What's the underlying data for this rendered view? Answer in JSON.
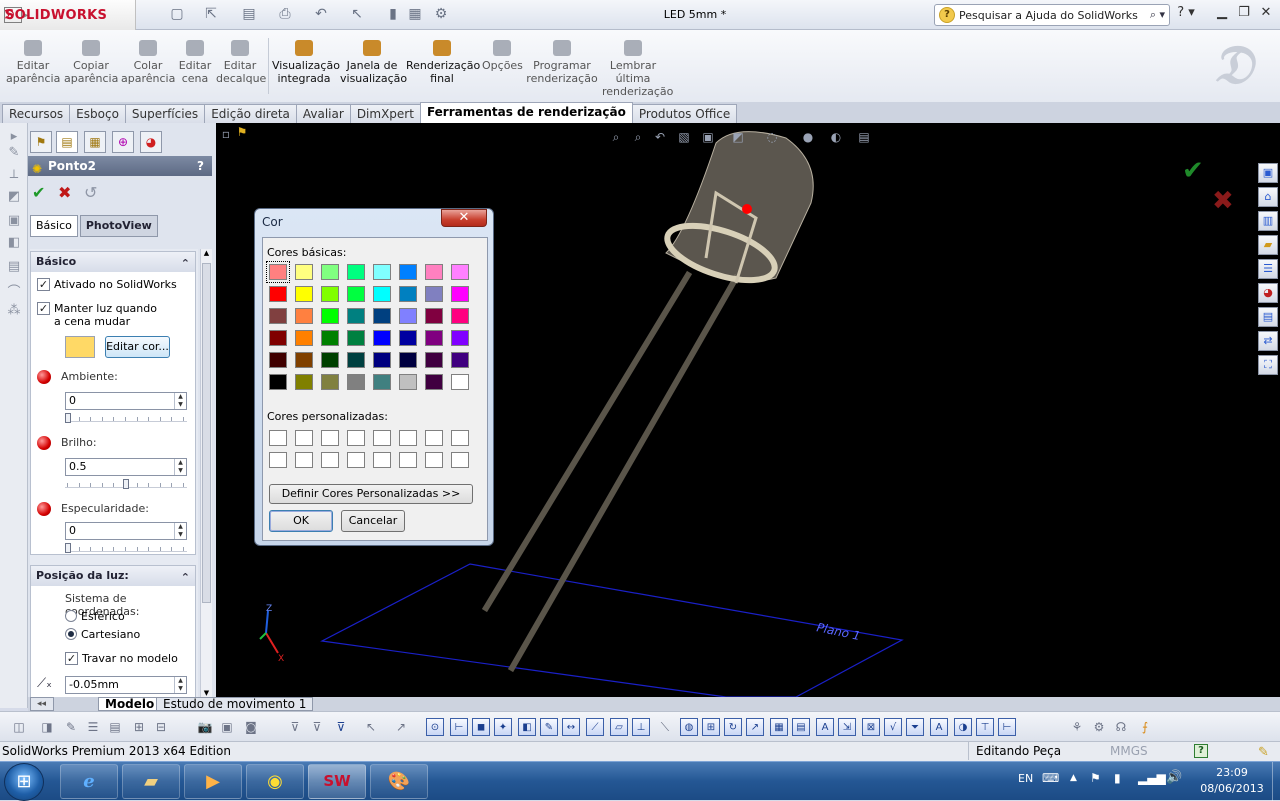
{
  "app": {
    "brand": "SOLIDWORKS",
    "document_title": "LED 5mm *",
    "help_search_placeholder": "Pesquisar a Ajuda do SolidWorks"
  },
  "ribbon": {
    "buttons": [
      {
        "label": "Editar aparência"
      },
      {
        "label": "Copiar aparência"
      },
      {
        "label": "Colar aparência"
      },
      {
        "label": "Editar cena"
      },
      {
        "label": "Editar decalque"
      },
      {
        "label": "Visualização integrada"
      },
      {
        "label": "Janela de visualização"
      },
      {
        "label": "Renderização final"
      },
      {
        "label": "Opções"
      },
      {
        "label": "Programar renderização"
      },
      {
        "label": "Lembrar última renderização"
      }
    ]
  },
  "tabs": [
    "Recursos",
    "Esboço",
    "Superfícies",
    "Edição direta",
    "Avaliar",
    "DimXpert",
    "Ferramentas de renderização",
    "Produtos Office"
  ],
  "active_tab": "Ferramentas de renderização",
  "property_manager": {
    "title": "Ponto2",
    "help": "?",
    "subtabs": [
      "Básico",
      "PhotoView"
    ],
    "basic_group": {
      "header": "Básico",
      "enabled_in_solidworks": "Ativado no SolidWorks",
      "keep_light": "Manter luz quando a cena mudar",
      "edit_color_button": "Editar cor...",
      "color": "#ffd966",
      "ambient_label": "Ambiente:",
      "ambient_value": "0",
      "ambient_fraction": 0,
      "brightness_label": "Brilho:",
      "brightness_value": "0.5",
      "brightness_fraction": 0.5,
      "specular_label": "Especularidade:",
      "specular_value": "0",
      "specular_fraction": 0
    },
    "position_group": {
      "header": "Posição da luz:",
      "coord_system_label": "Sistema de coordenadas:",
      "spherical": "Esférico",
      "cartesian": "Cartesiano",
      "lock_to_model": "Travar no modelo",
      "x_value": "-0.05mm"
    }
  },
  "color_dialog": {
    "title": "Cor",
    "close": "✕",
    "basic_colors_label": "Cores básicas:",
    "basic_colors": [
      [
        "#ff8080",
        "#ffff80",
        "#80ff80",
        "#00ff80",
        "#80ffff",
        "#0080ff",
        "#ff80c0",
        "#ff80ff"
      ],
      [
        "#ff0000",
        "#ffff00",
        "#80ff00",
        "#00ff40",
        "#00ffff",
        "#0080c0",
        "#8080c0",
        "#ff00ff"
      ],
      [
        "#804040",
        "#ff8040",
        "#00ff00",
        "#008080",
        "#004080",
        "#8080ff",
        "#800040",
        "#ff0080"
      ],
      [
        "#800000",
        "#ff8000",
        "#008000",
        "#008040",
        "#0000ff",
        "#0000a0",
        "#800080",
        "#8000ff"
      ],
      [
        "#400000",
        "#804000",
        "#004000",
        "#004040",
        "#000080",
        "#000040",
        "#400040",
        "#400080"
      ],
      [
        "#000000",
        "#808000",
        "#808040",
        "#808080",
        "#408080",
        "#c0c0c0",
        "#400040",
        "#ffffff"
      ]
    ],
    "custom_colors_label": "Cores personalizadas:",
    "define_custom_button": "Definir Cores Personalizadas >>",
    "ok_button": "OK",
    "cancel_button": "Cancelar"
  },
  "viewport": {
    "plane_label": "Plano 1",
    "axis_z": "Z",
    "axis_x": "X"
  },
  "bottom_tabs": [
    "Modelo",
    "Estudo de movimento 1"
  ],
  "statusbar": {
    "edition": "SolidWorks Premium 2013 x64 Edition",
    "mode": "Editando Peça",
    "units": "MMGS",
    "help": "?"
  },
  "taskbar": {
    "language": "EN",
    "time": "23:09",
    "date": "08/06/2013"
  }
}
